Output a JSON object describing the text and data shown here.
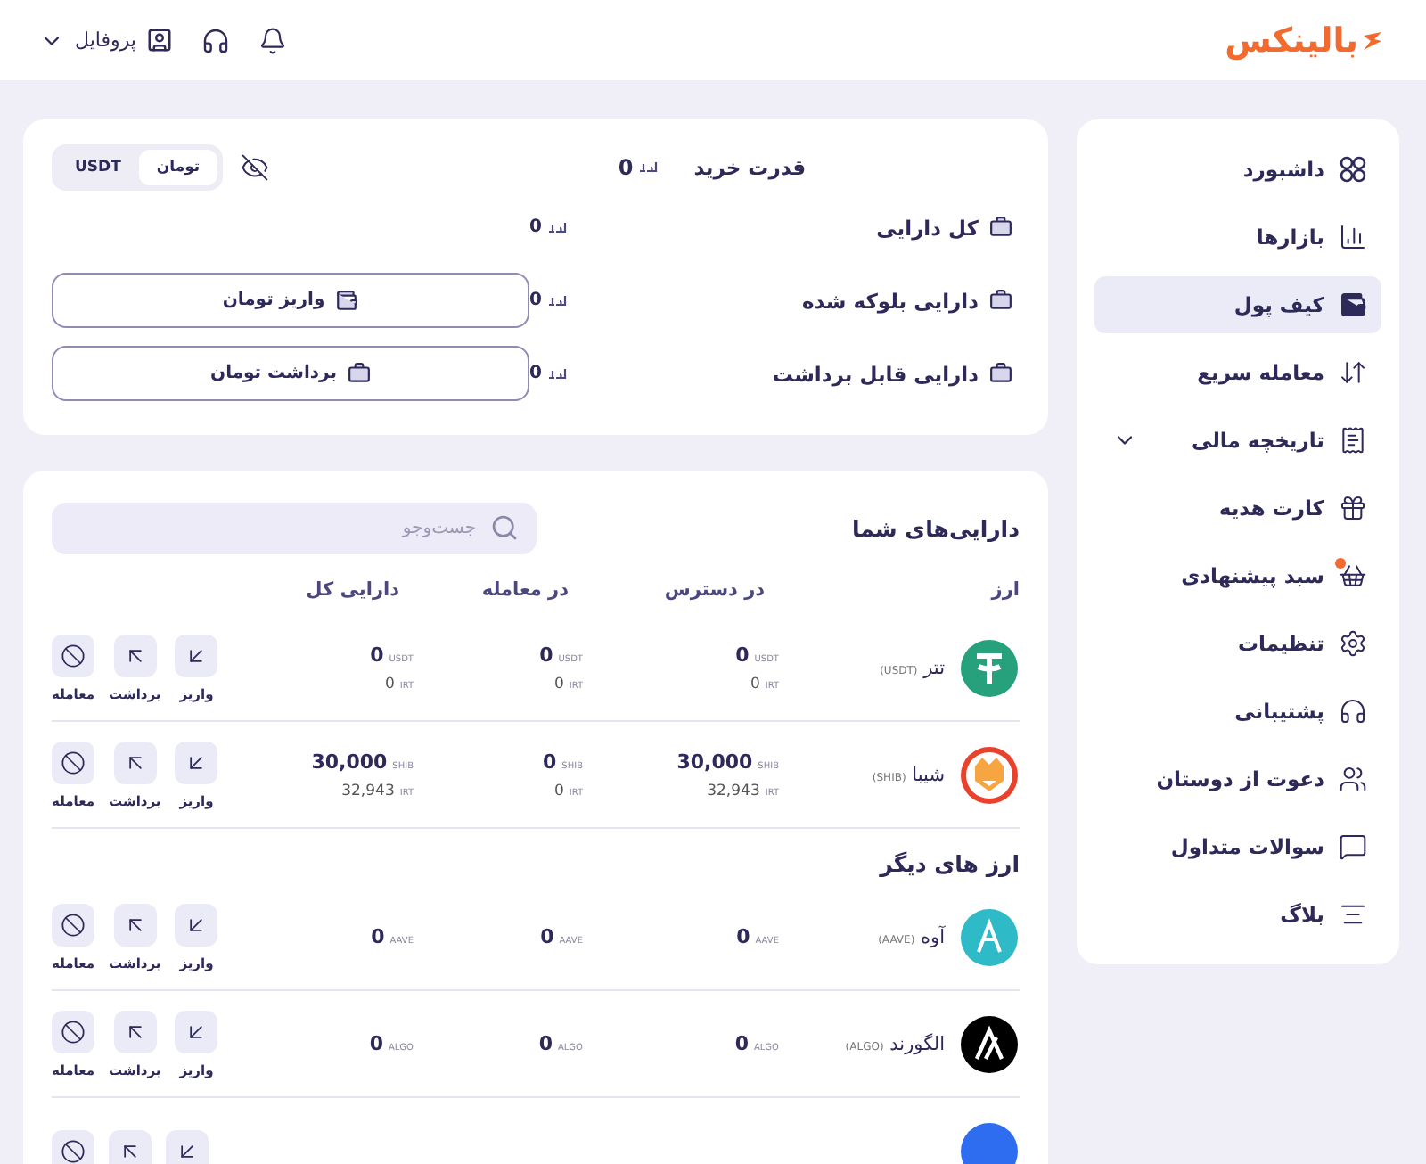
{
  "header": {
    "logo": "بالینکس",
    "profile": {
      "label": "پروفایل"
    }
  },
  "sidebar": {
    "items": [
      {
        "label": "داشبورد",
        "selected": false
      },
      {
        "label": "بازارها",
        "selected": false
      },
      {
        "label": "کیف پول",
        "selected": true
      },
      {
        "label": "معامله سریع",
        "selected": false
      },
      {
        "label": "تاریخچه مالی",
        "selected": false,
        "expanded": false
      },
      {
        "label": "کارت هدیه",
        "selected": false
      },
      {
        "label": "سبد پیشنهادی",
        "selected": false,
        "has_dot": true
      },
      {
        "label": "تنظیمات",
        "selected": false
      },
      {
        "label": "پشتیبانی",
        "selected": false
      },
      {
        "label": "دعوت از دوستان",
        "selected": false
      },
      {
        "label": "سوالات متداول",
        "selected": false
      },
      {
        "label": "بلاگ",
        "selected": false
      }
    ]
  },
  "summary": {
    "purchase_power": {
      "label": "قدرت خرید",
      "value": "0"
    },
    "unit_toggle": [
      {
        "label": "تومان",
        "selected": true
      },
      {
        "label": "USDT",
        "selected": false
      }
    ],
    "rows": [
      {
        "label": "کل دارایی",
        "value": "0"
      },
      {
        "label": "دارایی بلوکه شده",
        "value": "0",
        "button": {
          "label": "واریز تومان",
          "kind": "deposit"
        }
      },
      {
        "label": "دارایی قابل برداشت",
        "value": "0",
        "button": {
          "label": "برداشت تومان",
          "kind": "withdraw"
        }
      }
    ]
  },
  "assets": {
    "title": "دارایی‌های شما",
    "search": {
      "placeholder": "جست‌وجو"
    },
    "columns": [
      "ارز",
      "در دسترس",
      "در معامله",
      "دارایی کل"
    ],
    "rows": [
      {
        "name": "تتر",
        "symbol": "(USDT)",
        "color": "#26a17b",
        "available": {
          "amount": "0",
          "unit": "USDT",
          "irt": "0",
          "irt_unit": "IRT"
        },
        "in_trade": {
          "amount": "0",
          "unit": "USDT",
          "irt": "0",
          "irt_unit": "IRT"
        },
        "total": {
          "amount": "0",
          "unit": "USDT",
          "irt": "0",
          "irt_unit": "IRT"
        },
        "actions": [
          {
            "kind": "deposit",
            "label": "واریز"
          },
          {
            "kind": "withdraw",
            "label": "برداشت"
          },
          {
            "kind": "trade",
            "label": "معامله"
          }
        ]
      },
      {
        "name": "شیبا",
        "symbol": "(SHIB)",
        "color": "#e8412c",
        "available": {
          "amount": "30,000",
          "unit": "SHIB",
          "irt": "32,943",
          "irt_unit": "IRT"
        },
        "in_trade": {
          "amount": "0",
          "unit": "SHIB",
          "irt": "0",
          "irt_unit": "IRT"
        },
        "total": {
          "amount": "30,000",
          "unit": "SHIB",
          "irt": "32,943",
          "irt_unit": "IRT"
        },
        "actions": [
          {
            "kind": "deposit",
            "label": "واریز"
          },
          {
            "kind": "withdraw",
            "label": "برداشت"
          },
          {
            "kind": "trade",
            "label": "معامله"
          }
        ]
      }
    ],
    "other_title": "ارز های دیگر",
    "other_rows": [
      {
        "name": "آوه",
        "symbol": "(AAVE)",
        "color": "#2ebac6",
        "available": {
          "amount": "0",
          "unit": "AAVE"
        },
        "in_trade": {
          "amount": "0",
          "unit": "AAVE"
        },
        "total": {
          "amount": "0",
          "unit": "AAVE"
        },
        "actions": [
          {
            "kind": "deposit",
            "label": "واریز"
          },
          {
            "kind": "withdraw",
            "label": "برداشت"
          },
          {
            "kind": "trade",
            "label": "معامله"
          }
        ]
      },
      {
        "name": "الگورند",
        "symbol": "(ALGO)",
        "color": "#000000",
        "available": {
          "amount": "0",
          "unit": "ALGO"
        },
        "in_trade": {
          "amount": "0",
          "unit": "ALGO"
        },
        "total": {
          "amount": "0",
          "unit": "ALGO"
        },
        "actions": [
          {
            "kind": "deposit",
            "label": "واریز"
          },
          {
            "kind": "withdraw",
            "label": "برداشت"
          },
          {
            "kind": "trade",
            "label": "معامله"
          }
        ]
      },
      {
        "color": "#2f6df0",
        "actions": [
          {
            "kind": "deposit"
          },
          {
            "kind": "withdraw"
          },
          {
            "kind": "trade"
          }
        ]
      }
    ]
  }
}
